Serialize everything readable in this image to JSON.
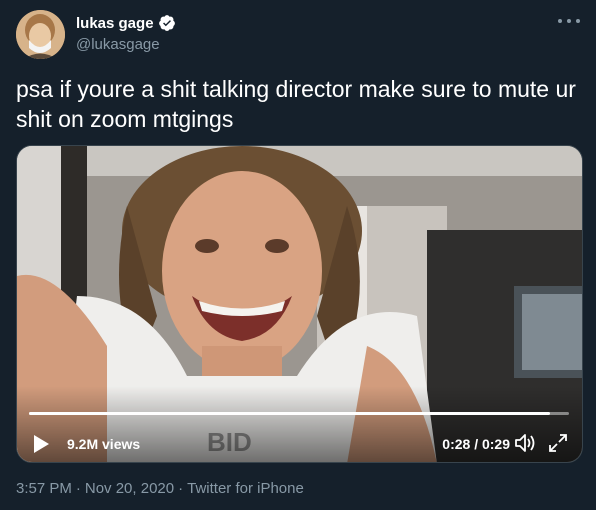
{
  "user": {
    "display_name": "lukas gage",
    "handle": "@lukasgage",
    "verified_icon": "verified-badge-icon"
  },
  "tweet": {
    "text": "psa if youre a shit talking director make sure to mute ur shit on zoom mtgings"
  },
  "video": {
    "views": "9.2M views",
    "time": "0:28 / 0:29",
    "progress": 0.965
  },
  "meta": {
    "time": "3:57 PM",
    "separator1": "·",
    "date": "Nov 20, 2020",
    "separator2": "·",
    "source": "Twitter for iPhone"
  },
  "colors": {
    "background": "#15202b",
    "secondary_text": "#8899a6",
    "verified_blue": "#ffffff"
  }
}
